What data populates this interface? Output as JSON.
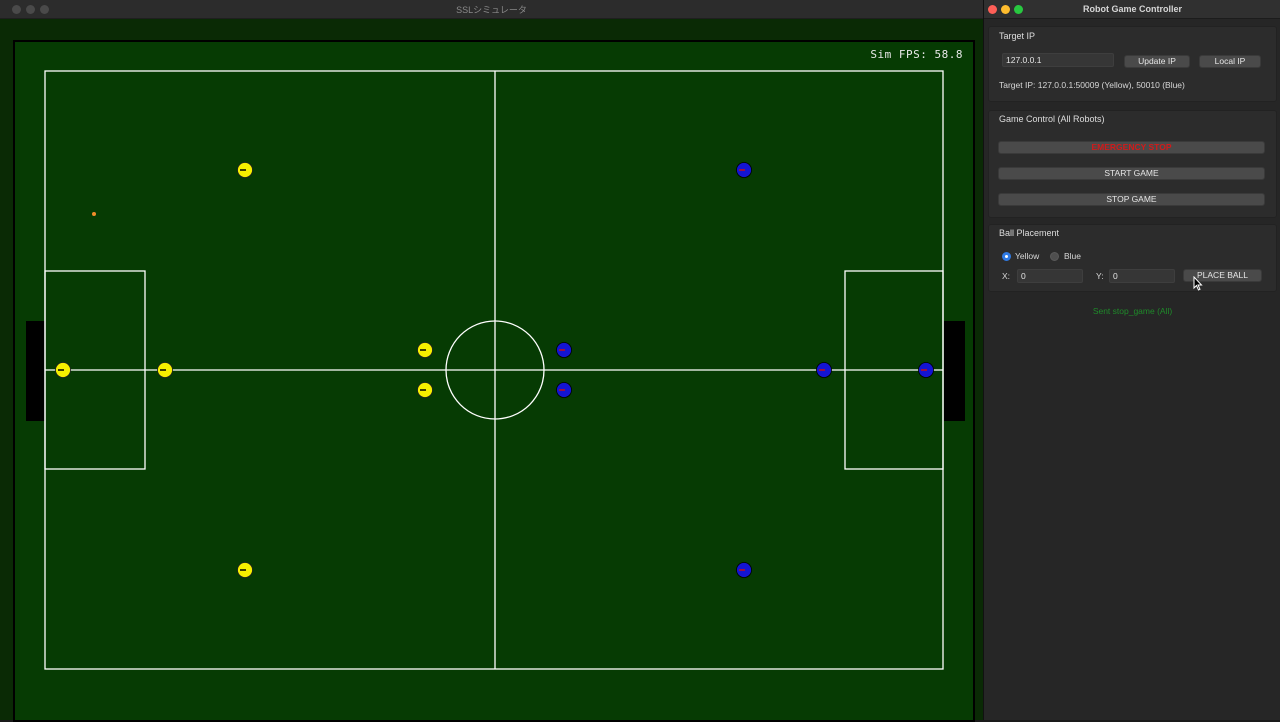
{
  "simulator": {
    "window_title": "SSLシミュレータ",
    "fps_text": "Sim FPS: 58.8",
    "field": {
      "line_color": "#ffffff",
      "grass_color": "#063b03",
      "goal_color": "#000000"
    },
    "ball": {
      "color": "#f08c2a"
    },
    "robots": {
      "yellow_color": "#f6f000",
      "blue_color": "#1414d2"
    }
  },
  "controller": {
    "window_title": "Robot Game Controller",
    "target_ip": {
      "section_label": "Target IP",
      "ip_value": "127.0.0.1",
      "update_button": "Update IP",
      "local_button": "Local IP",
      "status_text": "Target IP: 127.0.0.1:50009 (Yellow), 50010 (Blue)"
    },
    "game_control": {
      "section_label": "Game Control (All Robots)",
      "emergency_button": "EMERGENCY STOP",
      "emergency_color": "#d21a1a",
      "start_button": "START GAME",
      "stop_button": "STOP GAME"
    },
    "ball_placement": {
      "section_label": "Ball Placement",
      "team_options": [
        "Yellow",
        "Blue"
      ],
      "selected_team": "Yellow",
      "x_label": "X:",
      "x_value": "0",
      "y_label": "Y:",
      "y_value": "0",
      "place_button": "PLACE BALL"
    },
    "status_message": "Sent stop_game (All)",
    "status_color": "#1f8a2a",
    "accent_color": "#2f7ae5"
  }
}
